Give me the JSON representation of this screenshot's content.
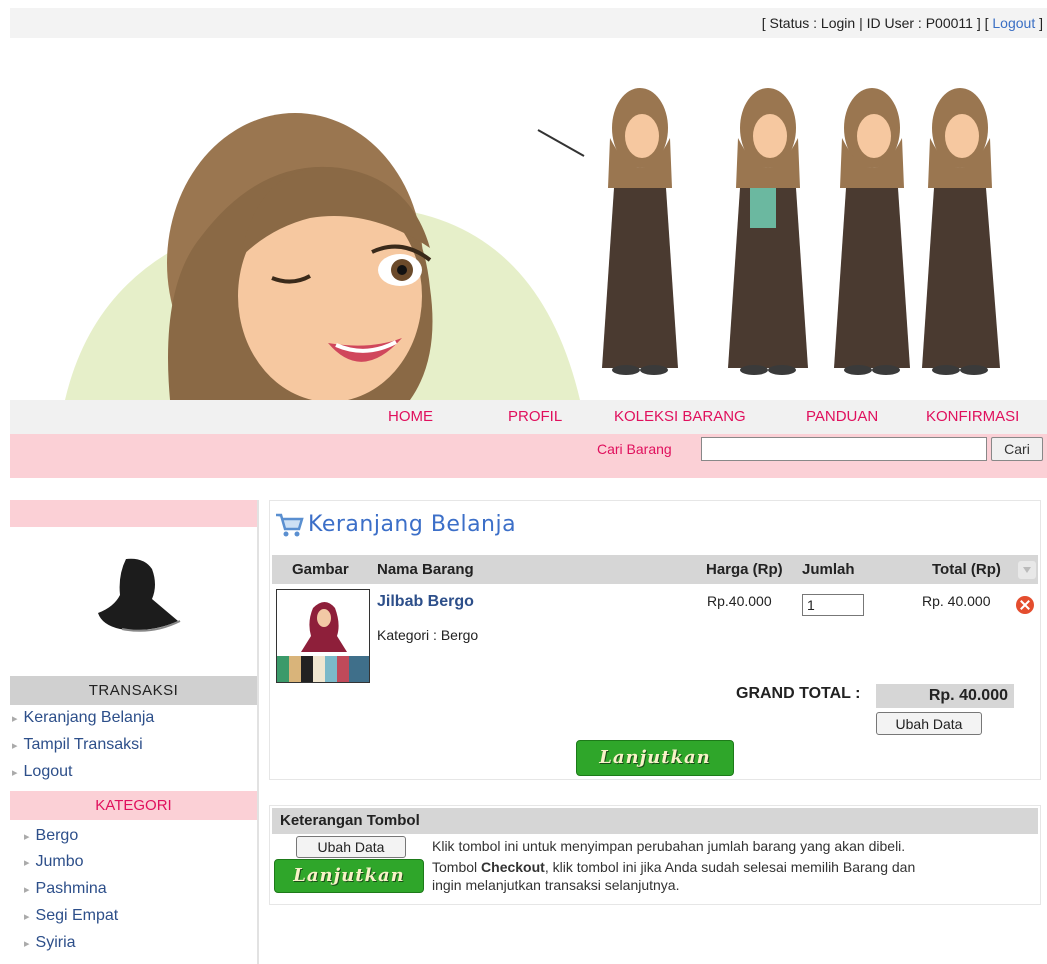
{
  "status": {
    "prefix": "[ Status : Login | ID User : P00011 ] [ ",
    "logout": "Logout",
    "suffix": " ]"
  },
  "nav": {
    "items": [
      "HOME",
      "PROFIL",
      "KOLEKSI BARANG",
      "PANDUAN",
      "KONFIRMASI"
    ]
  },
  "search": {
    "label": "Cari Barang",
    "value": "",
    "button": "Cari"
  },
  "sidebar": {
    "transaksi_heading": "TRANSAKSI",
    "transaksi_items": [
      "Keranjang Belanja",
      "Tampil Transaksi",
      "Logout"
    ],
    "kategori_heading": "KATEGORI",
    "kategori_items": [
      "Bergo",
      "Jumbo",
      "Pashmina",
      "Segi Empat",
      "Syiria"
    ]
  },
  "cart": {
    "title": "Keranjang Belanja",
    "columns": [
      "Gambar",
      "Nama Barang",
      "Harga (Rp)",
      "Jumlah",
      "Total (Rp)"
    ],
    "item": {
      "name": "Jilbab Bergo",
      "category": "Kategori : Bergo",
      "price": "Rp.40.000",
      "qty": "1",
      "total": "Rp. 40.000"
    },
    "grand_total_label": "GRAND TOTAL :",
    "grand_total_value": "Rp. 40.000",
    "update_button": "Ubah Data",
    "continue_button": "Lanjutkan"
  },
  "keterangan": {
    "heading": "Keterangan Tombol",
    "update_button": "Ubah Data",
    "update_desc": "Klik tombol ini untuk menyimpan perubahan jumlah barang yang akan dibeli.",
    "continue_button": "Lanjutkan",
    "continue_desc_1": "Tombol ",
    "continue_desc_bold": "Checkout",
    "continue_desc_2": ", klik tombol ini jika Anda sudah selesai memilih Barang dan",
    "continue_desc_3": "ingin melanjutkan transaksi selanjutnya."
  },
  "colors": {
    "accent_pink": "#e0105d",
    "pink_bar": "#fbd0d6",
    "link_blue": "#2d4f8a",
    "button_green": "#2fa62a"
  }
}
